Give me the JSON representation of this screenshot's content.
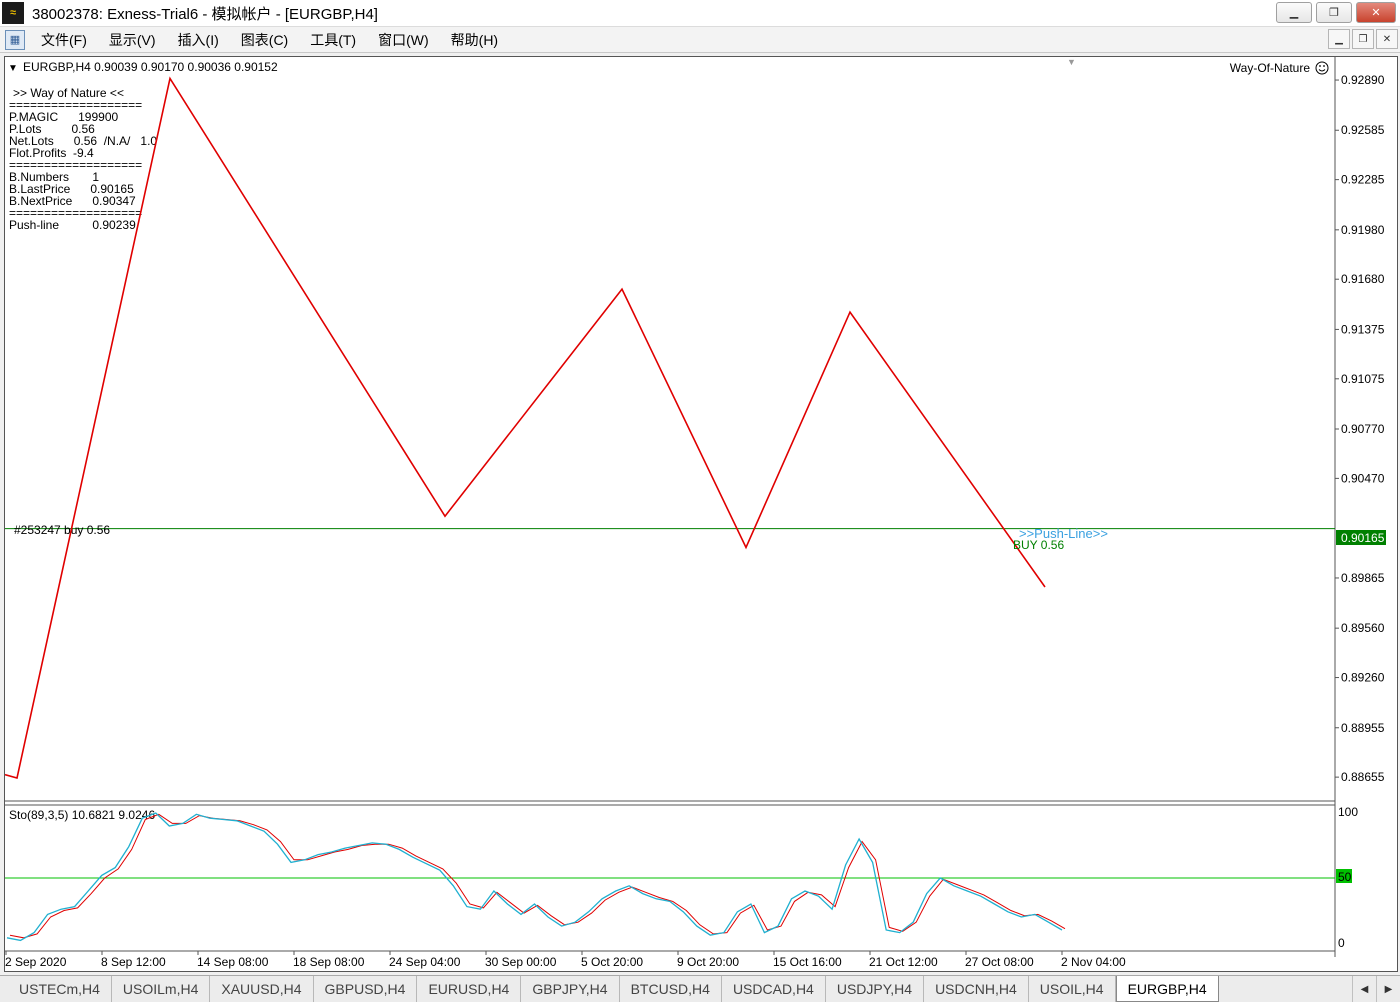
{
  "window": {
    "title": "38002378: Exness-Trial6 - 模拟帐户 - [EURGBP,H4]",
    "app_icon": "mt4-logo-icon",
    "buttons": [
      "minimize",
      "restore",
      "close"
    ]
  },
  "menu": {
    "items": [
      "文件(F)",
      "显示(V)",
      "插入(I)",
      "图表(C)",
      "工具(T)",
      "窗口(W)",
      "帮助(H)"
    ]
  },
  "chart": {
    "header": "EURGBP,H4  0.90039 0.90170 0.90036 0.90152",
    "ea_name": "Way-Of-Nature",
    "ea_icon": "smiley-icon",
    "panel": [
      ">> Way of Nature <<",
      "===================",
      "P.MAGIC      199900",
      "P.Lots         0.56",
      "Net.Lots      0.56  /N.A/   1.0",
      "Flot.Profits  -9.4",
      "===================",
      "B.Numbers       1",
      "B.LastPrice      0.90165",
      "B.NextPrice      0.90347",
      "===================",
      "Push-line          0.90239"
    ],
    "order_label": "#253247 buy 0.56",
    "push_line_label": ">>Push-Line>>",
    "buy_label": "BUY  0.56",
    "current_price": "0.90165",
    "price_ticks": [
      "0.92890",
      "0.92585",
      "0.92285",
      "0.91980",
      "0.91680",
      "0.91375",
      "0.91075",
      "0.90770",
      "0.90470",
      "0.89865",
      "0.89560",
      "0.89260",
      "0.88955",
      "0.88655"
    ],
    "time_ticks": [
      "2 Sep 2020",
      "8 Sep 12:00",
      "14 Sep 08:00",
      "18 Sep 08:00",
      "24 Sep 04:00",
      "30 Sep 00:00",
      "5 Oct 20:00",
      "9 Oct 20:00",
      "15 Oct 16:00",
      "21 Oct 12:00",
      "27 Oct 08:00",
      "2 Nov 04:00"
    ],
    "colors": {
      "zigzag": "#e00000",
      "level_line": "#008000",
      "stoch_main": "#20b0d0",
      "stoch_signal": "#e00000",
      "stoch_level": "#00c000"
    }
  },
  "chart_data": {
    "type": "line",
    "zigzag_prices": [
      0.8867,
      0.8865,
      0.929,
      0.9024,
      0.9162,
      0.9005,
      0.9148,
      0.8981
    ],
    "ylim": [
      0.8851,
      0.9303
    ],
    "stochastic": {
      "label": "Sto(89,3,5) 10.6821 9.0246",
      "ylim": [
        0,
        100
      ],
      "level": "50",
      "ticks": [
        "100",
        "50",
        "0"
      ],
      "main_values": [
        4,
        2,
        8,
        22,
        26,
        28,
        40,
        52,
        58,
        74,
        96,
        100,
        90,
        92,
        99,
        96,
        95,
        94,
        90,
        86,
        76,
        62,
        64,
        68,
        70,
        73,
        75,
        77,
        76,
        72,
        66,
        61,
        56,
        44,
        28,
        26,
        40,
        30,
        22,
        30,
        20,
        13,
        16,
        24,
        34,
        40,
        44,
        38,
        34,
        32,
        24,
        13,
        6,
        8,
        24,
        30,
        8,
        13,
        34,
        40,
        36,
        26,
        60,
        80,
        62,
        10,
        8,
        16,
        38,
        50,
        44,
        40,
        36,
        30,
        24,
        20,
        22,
        16,
        10
      ],
      "signal_values": [
        6,
        4,
        7,
        20,
        25,
        27,
        38,
        50,
        57,
        72,
        95,
        99,
        92,
        92,
        98,
        96,
        95,
        94,
        91,
        87,
        78,
        64,
        64,
        67,
        70,
        72,
        75,
        76,
        76,
        73,
        67,
        62,
        57,
        46,
        30,
        27,
        39,
        31,
        23,
        29,
        21,
        14,
        16,
        23,
        33,
        39,
        43,
        39,
        35,
        32,
        25,
        14,
        7,
        8,
        23,
        29,
        10,
        13,
        32,
        39,
        37,
        28,
        58,
        78,
        64,
        12,
        9,
        16,
        36,
        49,
        45,
        41,
        37,
        31,
        25,
        21,
        22,
        17,
        11
      ]
    }
  }
}
